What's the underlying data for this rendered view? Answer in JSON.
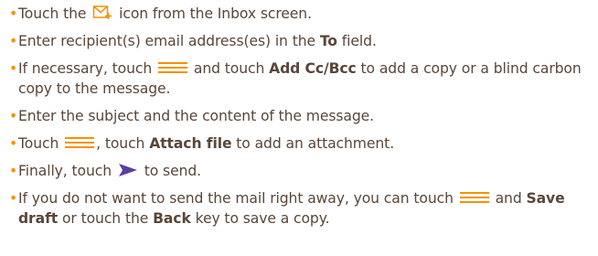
{
  "colors": {
    "bullet": "#f39200",
    "text": "#5a4638",
    "icon": "#f39200",
    "send_icon": "#5b3e9e"
  },
  "items": [
    {
      "before": "Touch the ",
      "icon": "compose-icon",
      "after": " icon from the Inbox screen."
    },
    {
      "before": "Enter recipient(s) email address(es) in the ",
      "bold": "To",
      "after": " field."
    },
    {
      "before": "If necessary, touch ",
      "icon": "menu-icon",
      "middle": " and touch ",
      "bold": "Add Cc/Bcc",
      "after": " to add a copy or a blind carbon copy to the message."
    },
    {
      "text": "Enter the subject and the content of the message."
    },
    {
      "before": "Touch ",
      "icon": "menu-icon",
      "middle": ", touch ",
      "bold": "Attach file",
      "after": " to add an attachment."
    },
    {
      "before": "Finally, touch ",
      "icon": "send-icon",
      "after": " to send."
    },
    {
      "before": "If you do not want to send the mail right away, you can touch ",
      "icon": "menu-icon",
      "middle": " and ",
      "bold": "Save draft",
      "middle2": " or touch the ",
      "bold2": "Back",
      "after": " key to save a copy."
    }
  ]
}
